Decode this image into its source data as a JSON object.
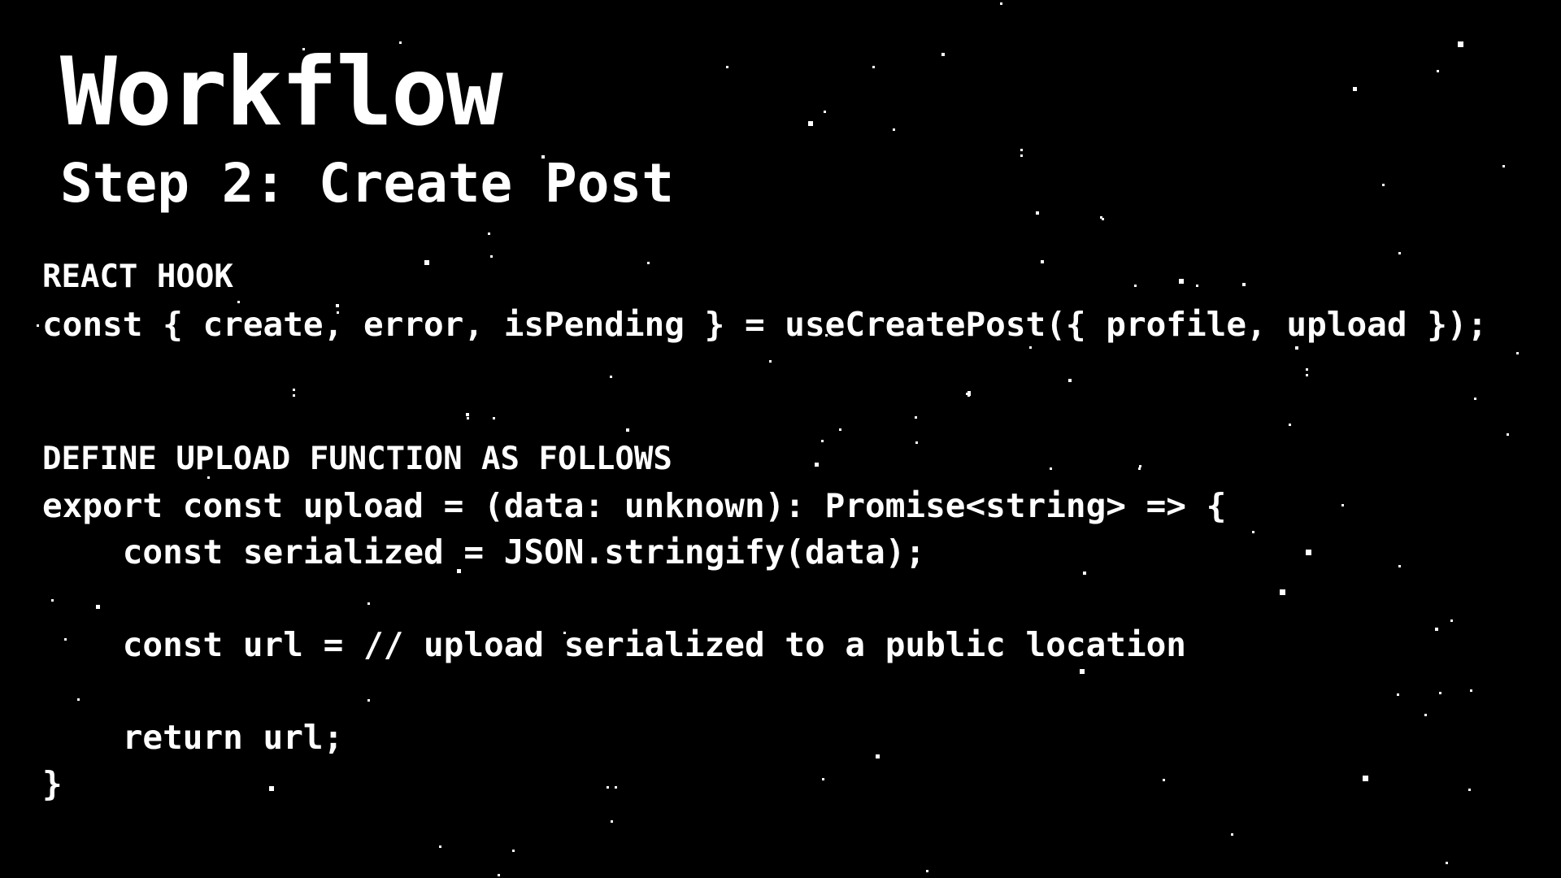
{
  "slide": {
    "title": "Workflow",
    "subtitle": "Step 2: Create Post"
  },
  "hook_section": {
    "label": "REACT HOOK",
    "code": "const { create, error, isPending } = useCreatePost({ profile, upload });"
  },
  "upload_section": {
    "label": "DEFINE UPLOAD FUNCTION AS FOLLOWS",
    "lines": [
      "export const upload = (data: unknown): Promise<string> => {",
      "    const serialized = JSON.stringify(data);",
      "    const url = // upload serialized to a public location",
      "    return url;",
      "}"
    ]
  },
  "colors": {
    "background": "#000000",
    "text": "#ffffff",
    "stars": "#ffffff"
  }
}
